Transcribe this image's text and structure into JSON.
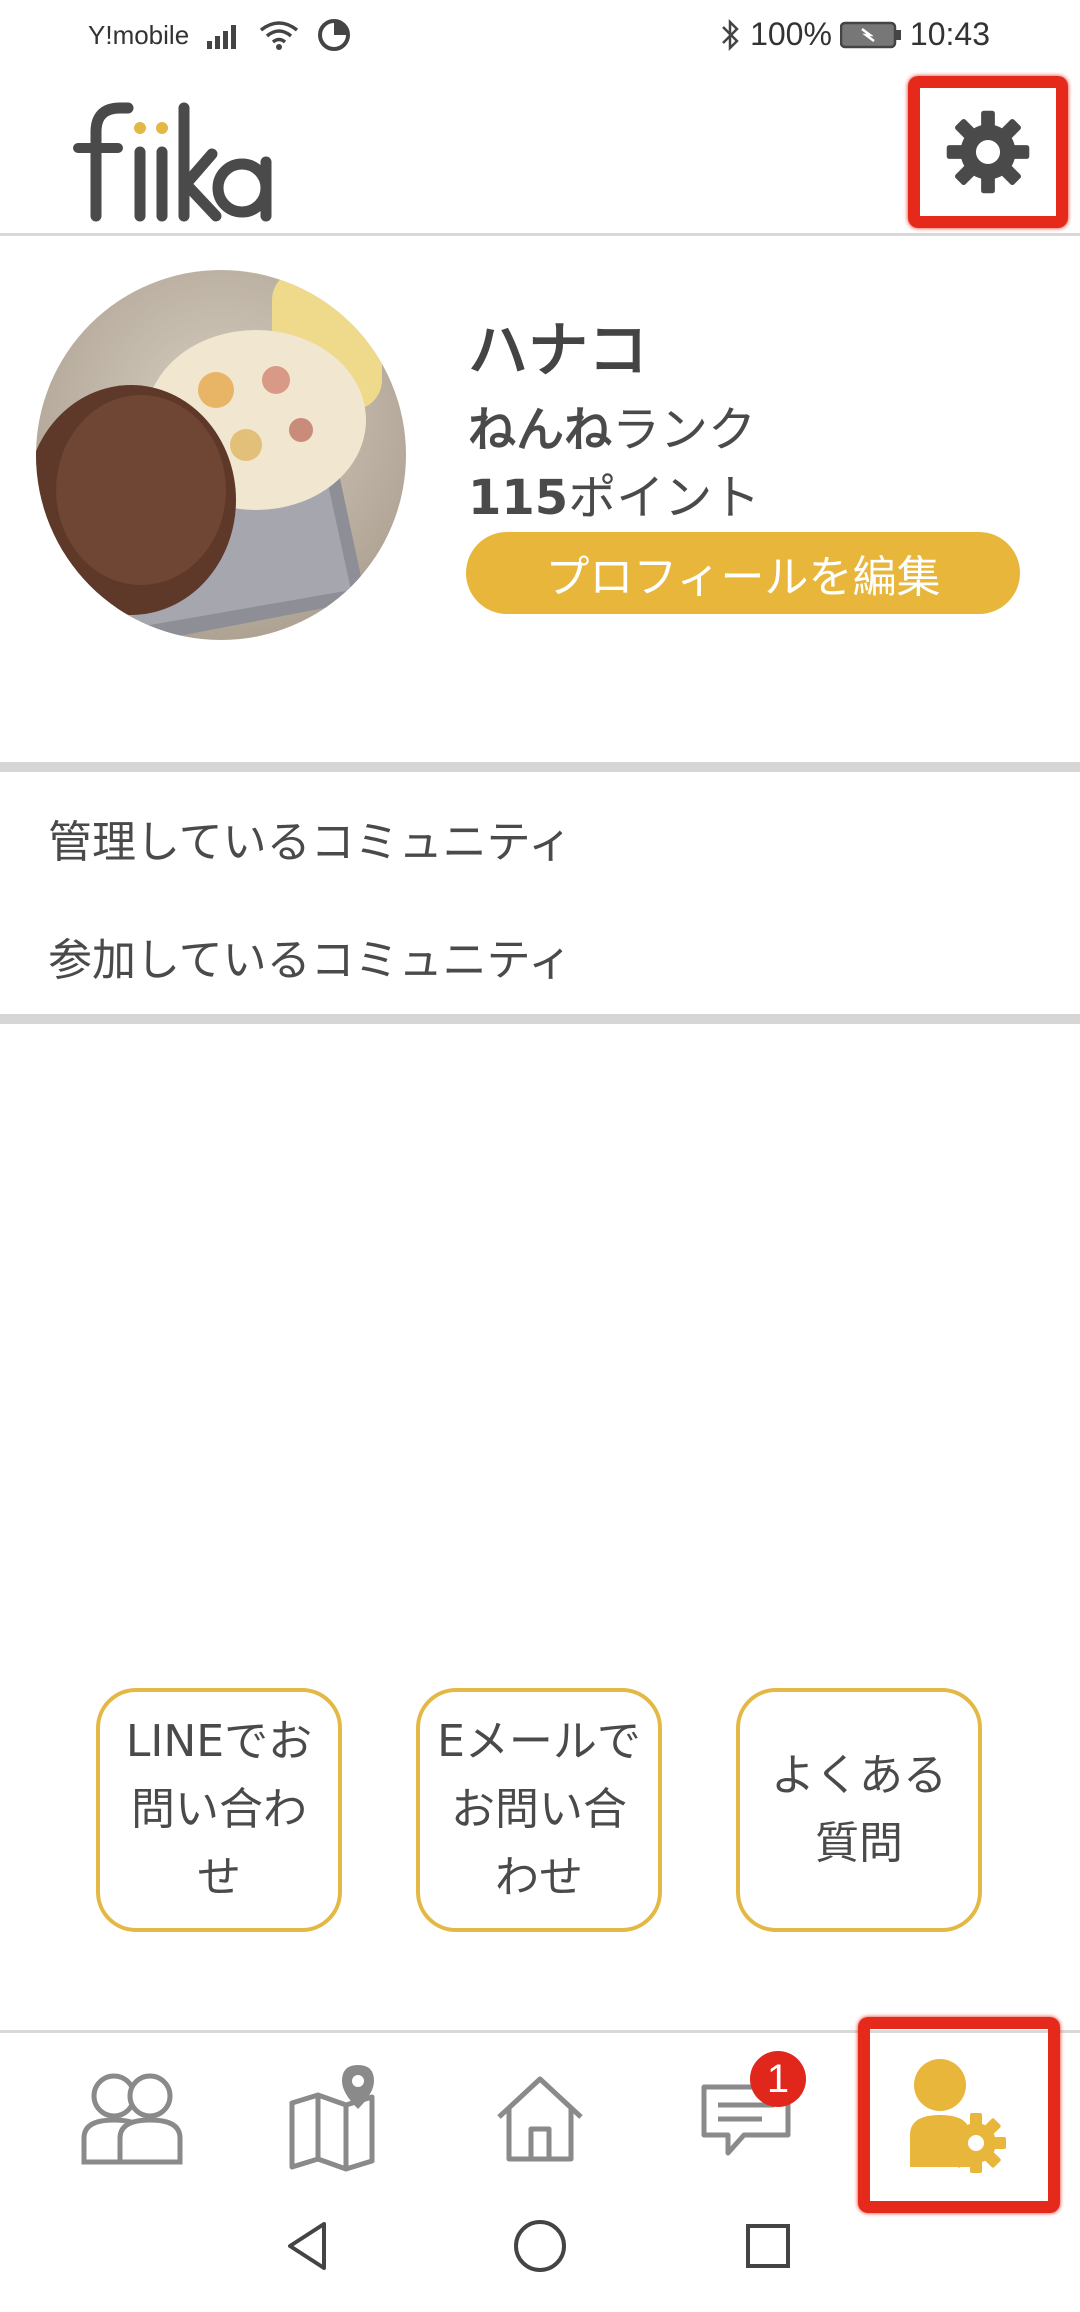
{
  "status_bar": {
    "carrier": "Y!mobile",
    "battery": "100%",
    "time": "10:43"
  },
  "header": {
    "logo": "fiika",
    "settings_icon": "gear-icon"
  },
  "profile": {
    "name": "ハナコ",
    "rank_bold": "ねんね",
    "rank_suffix": "ランク",
    "points_bold": "115",
    "points_suffix": "ポイント",
    "edit_label": "プロフィールを編集"
  },
  "menu": {
    "managed": "管理しているコミュニティ",
    "joined": "参加しているコミュニティ"
  },
  "contact": {
    "line": "LINEでお問い合わせ",
    "email": "Eメールでお問い合わせ",
    "faq": "よくある質問"
  },
  "bottom_nav": {
    "items": [
      {
        "icon": "community-icon"
      },
      {
        "icon": "map-icon"
      },
      {
        "icon": "home-icon"
      },
      {
        "icon": "chat-icon",
        "badge": "1"
      },
      {
        "icon": "mypage-settings-icon"
      }
    ]
  },
  "colors": {
    "accent": "#e7b63a",
    "badge": "#e1261c",
    "highlight": "#e5291a",
    "text": "#4a4a4a"
  }
}
